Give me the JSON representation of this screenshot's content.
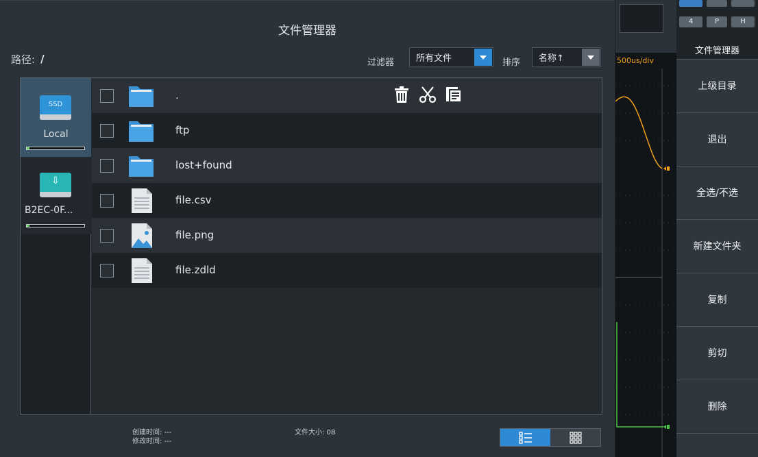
{
  "dialog": {
    "title": "文件管理器",
    "path_label": "路径:",
    "path_value": "/",
    "filter_label": "过滤器",
    "filter_value": "所有文件",
    "sort_label": "排序",
    "sort_value": "名称↑"
  },
  "drives": [
    {
      "icon_text": "SSD",
      "label": "Local",
      "usage_fraction": 0.05
    },
    {
      "icon_text": "⇩",
      "label": "B2EC-0F...",
      "usage_fraction": 0.05
    }
  ],
  "files": [
    {
      "name": ".",
      "type": "folder"
    },
    {
      "name": "ftp",
      "type": "folder"
    },
    {
      "name": "lost+found",
      "type": "folder"
    },
    {
      "name": "file.csv",
      "type": "document"
    },
    {
      "name": "file.png",
      "type": "image"
    },
    {
      "name": "file.zdld",
      "type": "document"
    }
  ],
  "actions": [
    {
      "icon": "trash-icon"
    },
    {
      "icon": "scissors-icon"
    },
    {
      "icon": "paste-icon"
    }
  ],
  "footer": {
    "created": "创建时间: ---",
    "modified": "修改时间: ---",
    "size": "文件大小: 0B"
  },
  "scope": {
    "timescale": "500us/div",
    "trace_color": "#f2a21c",
    "trace2_color": "#49c449"
  },
  "channels": [
    "4",
    "P",
    "H"
  ],
  "side_menu": {
    "title": "文件管理器",
    "items": [
      "上级目录",
      "退出",
      "全选/不选",
      "新建文件夹",
      "复制",
      "剪切",
      "删除"
    ]
  },
  "colors": {
    "accent": "#2f8ad6",
    "folder": "#3a93d6",
    "usb": "#27b6b4",
    "usage": "#5fd060"
  }
}
